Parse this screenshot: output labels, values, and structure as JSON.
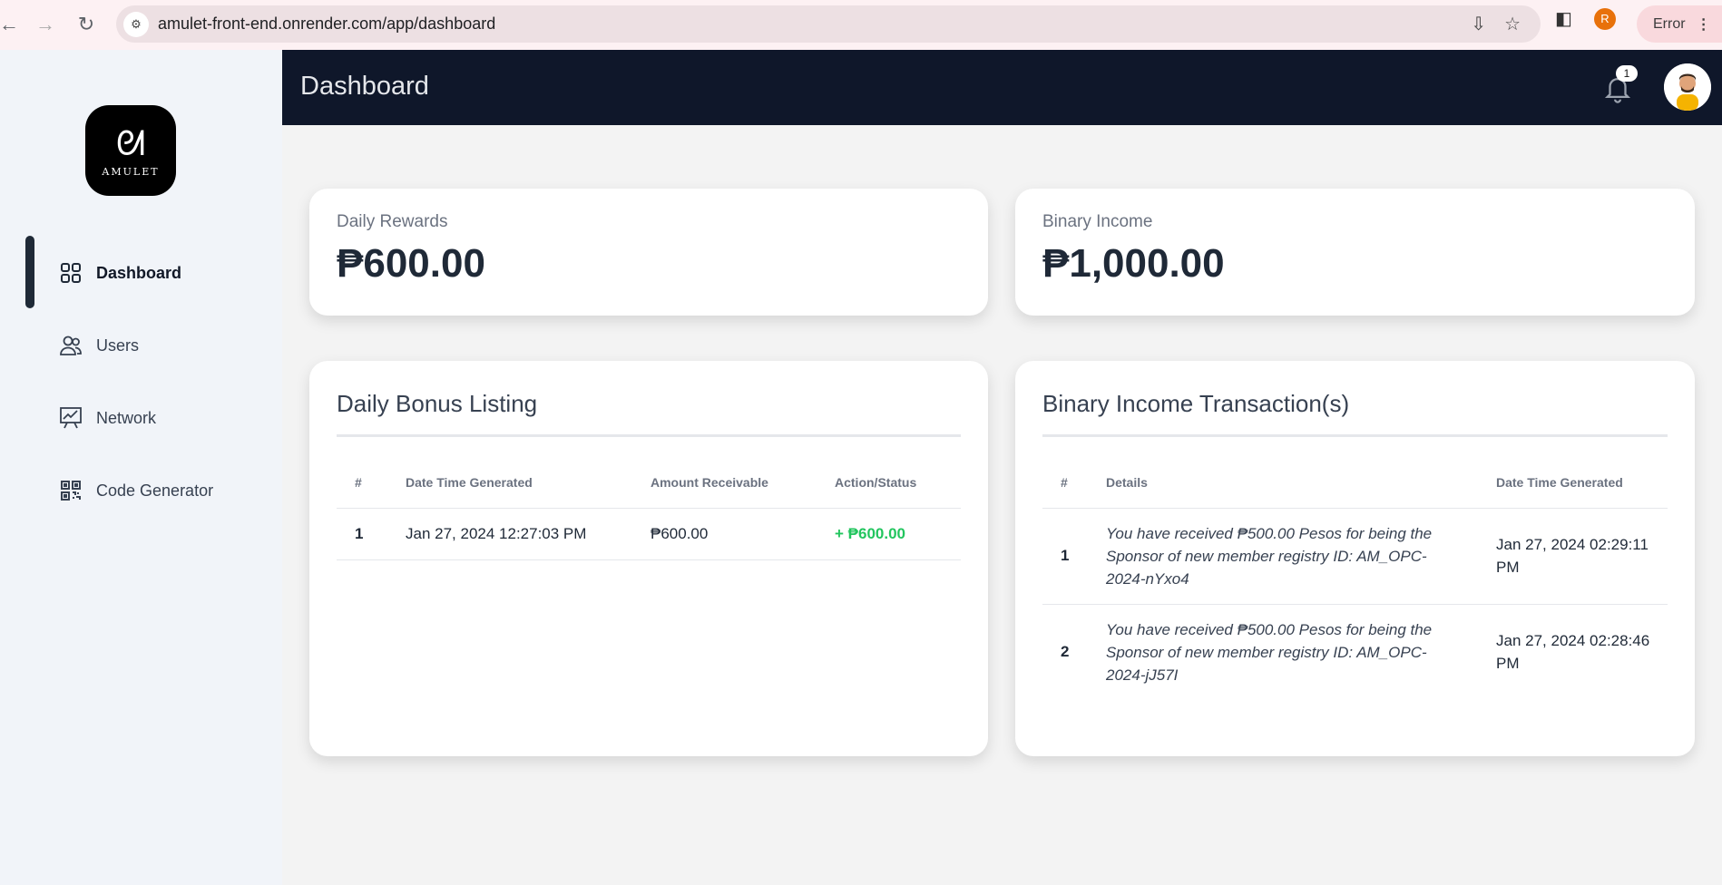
{
  "browser": {
    "url": "amulet-front-end.onrender.com/app/dashboard",
    "profile_initial": "R",
    "error_label": "Error"
  },
  "sidebar": {
    "logo_text": "AMULET",
    "items": [
      {
        "label": "Dashboard",
        "icon": "grid-icon",
        "active": true
      },
      {
        "label": "Users",
        "icon": "users-icon",
        "active": false
      },
      {
        "label": "Network",
        "icon": "chart-board-icon",
        "active": false
      },
      {
        "label": "Code Generator",
        "icon": "qr-code-icon",
        "active": false
      }
    ]
  },
  "header": {
    "title": "Dashboard",
    "notification_count": "1"
  },
  "stats": {
    "daily_rewards": {
      "label": "Daily Rewards",
      "value": "₱600.00"
    },
    "binary_income": {
      "label": "Binary Income",
      "value": "₱1,000.00"
    }
  },
  "daily_bonus": {
    "title": "Daily Bonus Listing",
    "columns": [
      "#",
      "Date Time Generated",
      "Amount Receivable",
      "Action/Status"
    ],
    "rows": [
      {
        "index": "1",
        "datetime": "Jan 27, 2024 12:27:03 PM",
        "amount": "₱600.00",
        "status": "+ ₱600.00"
      }
    ]
  },
  "binary_transactions": {
    "title": "Binary Income Transaction(s)",
    "columns": [
      "#",
      "Details",
      "Date Time Generated"
    ],
    "rows": [
      {
        "index": "1",
        "details": "You have received ₱500.00 Pesos for being the Sponsor of new member registry ID: AM_OPC-2024-nYxo4",
        "datetime": "Jan 27, 2024 02:29:11 PM"
      },
      {
        "index": "2",
        "details": "You have received ₱500.00 Pesos for being the Sponsor of new member registry ID: AM_OPC-2024-jJ57I",
        "datetime": "Jan 27, 2024 02:28:46 PM"
      }
    ]
  },
  "colors": {
    "header_bg": "#0f172a",
    "sidebar_bg": "#f1f4f9",
    "status_green": "#22c55e"
  }
}
